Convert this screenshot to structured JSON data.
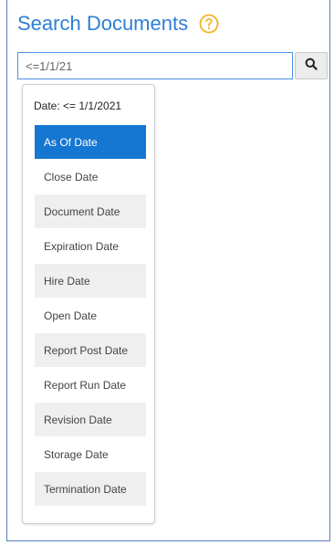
{
  "header": {
    "title": "Search Documents",
    "help_icon": "question-circle-icon",
    "help_color": "#f2b321"
  },
  "search": {
    "value": "<=1/1/21",
    "button_icon": "search-icon"
  },
  "dropdown": {
    "header": "Date: <= 1/1/2021",
    "selected": "As Of Date",
    "options": [
      "As Of Date",
      "Close Date",
      "Document Date",
      "Expiration Date",
      "Hire Date",
      "Open Date",
      "Report Post Date",
      "Report Run Date",
      "Revision Date",
      "Storage Date",
      "Termination Date"
    ]
  },
  "colors": {
    "title": "#2f7fd6",
    "selected_bg": "#1677d2",
    "panel_border": "#5a7fbf"
  }
}
